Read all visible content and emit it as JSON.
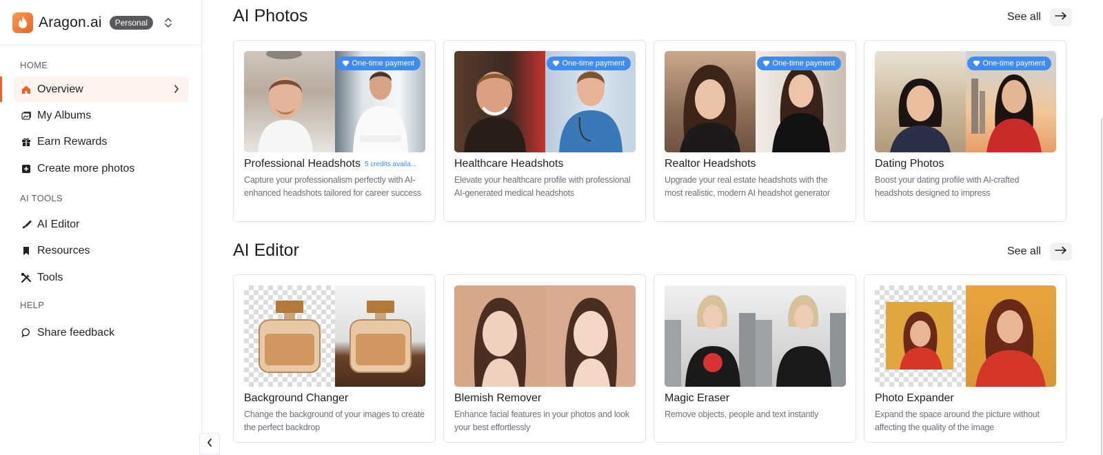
{
  "brand": {
    "name": "Aragon.ai",
    "badge": "Personal"
  },
  "sidebar": {
    "sections": [
      {
        "label": "HOME"
      },
      {
        "label": "AI TOOLS"
      },
      {
        "label": "HELP"
      }
    ],
    "items": [
      {
        "label": "Overview",
        "icon": "home-icon",
        "active": true
      },
      {
        "label": "My Albums",
        "icon": "albums-icon"
      },
      {
        "label": "Earn Rewards",
        "icon": "gift-icon"
      },
      {
        "label": "Create more photos",
        "icon": "plus-square-icon"
      },
      {
        "label": "AI Editor",
        "icon": "brush-icon"
      },
      {
        "label": "Resources",
        "icon": "bookmark-icon"
      },
      {
        "label": "Tools",
        "icon": "tools-icon"
      },
      {
        "label": "Share feedback",
        "icon": "chat-bubble-icon"
      }
    ]
  },
  "photos_section": {
    "title": "AI Photos",
    "see_all": "See all",
    "cards": [
      {
        "title": "Professional Headshots",
        "credits": "5 credits availa...",
        "desc": "Capture your professionalism perfectly with AI-enhanced headshots tailored for career success",
        "pill": "One-time payment"
      },
      {
        "title": "Healthcare Headshots",
        "desc": "Elevate your healthcare profile with professional AI-generated medical headshots",
        "pill": "One-time payment"
      },
      {
        "title": "Realtor Headshots",
        "desc": "Upgrade your real estate headshots with the most realistic, modern AI headshot generator",
        "pill": "One-time payment"
      },
      {
        "title": "Dating Photos",
        "desc": "Boost your dating profile with AI-crafted headshots designed to impress",
        "pill": "One-time payment"
      }
    ]
  },
  "editor_section": {
    "title": "AI Editor",
    "see_all": "See all",
    "cards": [
      {
        "title": "Background Changer",
        "desc": "Change the background of your images to create the perfect backdrop"
      },
      {
        "title": "Blemish Remover",
        "desc": "Enhance facial features in your photos and look your best effortlessly"
      },
      {
        "title": "Magic Eraser",
        "desc": "Remove objects, people and text instantly"
      },
      {
        "title": "Photo Expander",
        "desc": "Expand the space around the picture without affecting the quality of the image"
      }
    ]
  },
  "colors": {
    "accent": "#e8632a",
    "pill": "#3f8bf0"
  }
}
